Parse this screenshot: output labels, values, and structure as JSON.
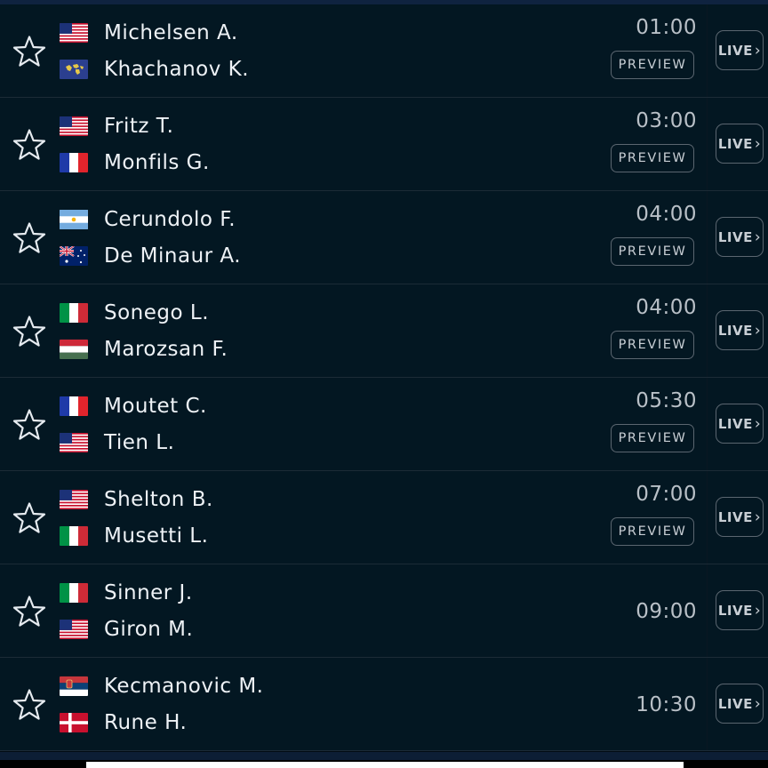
{
  "matches": [
    {
      "time": "01:00",
      "preview": "PREVIEW",
      "live": "LIVE",
      "p1": {
        "name": "Michelsen A.",
        "flag": "us-flag"
      },
      "p2": {
        "name": "Khachanov K.",
        "flag": "neutral-flag"
      }
    },
    {
      "time": "03:00",
      "preview": "PREVIEW",
      "live": "LIVE",
      "p1": {
        "name": "Fritz T.",
        "flag": "us-flag"
      },
      "p2": {
        "name": "Monfils G.",
        "flag": "france-flag"
      }
    },
    {
      "time": "04:00",
      "preview": "PREVIEW",
      "live": "LIVE",
      "p1": {
        "name": "Cerundolo F.",
        "flag": "argentina-flag"
      },
      "p2": {
        "name": "De Minaur A.",
        "flag": "australia-flag"
      }
    },
    {
      "time": "04:00",
      "preview": "PREVIEW",
      "live": "LIVE",
      "p1": {
        "name": "Sonego L.",
        "flag": "italy-flag"
      },
      "p2": {
        "name": "Marozsan F.",
        "flag": "hungary-flag"
      }
    },
    {
      "time": "05:30",
      "preview": "PREVIEW",
      "live": "LIVE",
      "p1": {
        "name": "Moutet C.",
        "flag": "france-flag"
      },
      "p2": {
        "name": "Tien L.",
        "flag": "us-flag"
      }
    },
    {
      "time": "07:00",
      "preview": "PREVIEW",
      "live": "LIVE",
      "p1": {
        "name": "Shelton B.",
        "flag": "us-flag"
      },
      "p2": {
        "name": "Musetti L.",
        "flag": "italy-flag"
      }
    },
    {
      "time": "09:00",
      "preview": "",
      "live": "LIVE",
      "p1": {
        "name": "Sinner J.",
        "flag": "italy-flag"
      },
      "p2": {
        "name": "Giron M.",
        "flag": "us-flag"
      }
    },
    {
      "time": "10:30",
      "preview": "",
      "live": "LIVE",
      "p1": {
        "name": "Kecmanovic M.",
        "flag": "serbia-flag"
      },
      "p2": {
        "name": "Rune H.",
        "flag": "denmark-flag"
      }
    }
  ],
  "icons": {
    "favorite": "star-outline-icon",
    "live_arrow": "chevron-right-icon"
  },
  "colors": {
    "background": "#031722",
    "text": "#eef2f6",
    "muted": "#b9c0c7",
    "border": "#5b6670"
  }
}
